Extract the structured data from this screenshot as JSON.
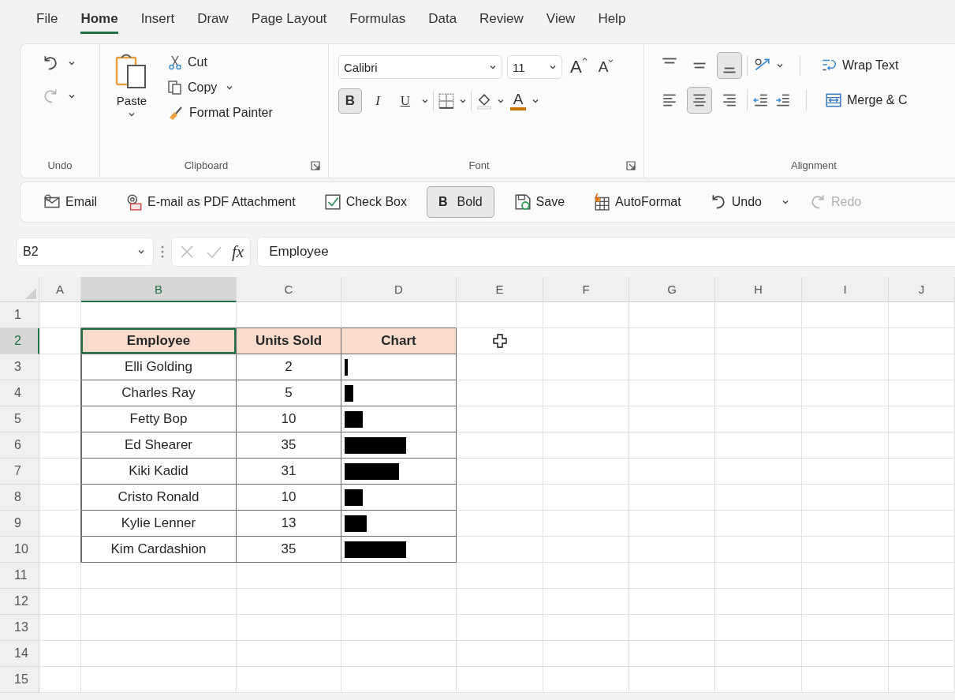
{
  "menu_tabs": [
    {
      "label": "File",
      "selected": false
    },
    {
      "label": "Home",
      "selected": true
    },
    {
      "label": "Insert",
      "selected": false
    },
    {
      "label": "Draw",
      "selected": false
    },
    {
      "label": "Page Layout",
      "selected": false
    },
    {
      "label": "Formulas",
      "selected": false
    },
    {
      "label": "Data",
      "selected": false
    },
    {
      "label": "Review",
      "selected": false
    },
    {
      "label": "View",
      "selected": false
    },
    {
      "label": "Help",
      "selected": false
    }
  ],
  "undo_group": {
    "label": "Undo",
    "redo_disabled": true
  },
  "clipboard": {
    "label": "Clipboard",
    "paste": "Paste",
    "cut": "Cut",
    "copy": "Copy",
    "format_painter": "Format Painter"
  },
  "font": {
    "label": "Font",
    "font_name": "Calibri",
    "font_size": "11",
    "grow": "A",
    "shrink": "A",
    "font_color": "A",
    "styles": [
      {
        "label": "B",
        "selected": true
      },
      {
        "label": "I",
        "selected": false
      },
      {
        "label": "U",
        "selected": false
      }
    ]
  },
  "alignment": {
    "label": "Alignment",
    "wrap_text": "Wrap Text",
    "merge": "Merge & C",
    "vertical": [
      {
        "selected": false
      },
      {
        "selected": false
      },
      {
        "selected": true
      }
    ],
    "horizontal": [
      {
        "selected": false
      },
      {
        "selected": true
      },
      {
        "selected": false
      }
    ]
  },
  "quick_access": [
    {
      "label": "Email",
      "selected": false,
      "disabled": false,
      "dropdown": false
    },
    {
      "label": "E-mail as PDF Attachment",
      "selected": false,
      "disabled": false,
      "dropdown": false
    },
    {
      "label": "Check Box",
      "selected": false,
      "disabled": false,
      "dropdown": false
    },
    {
      "label": "Bold",
      "glyph": "B",
      "selected": true,
      "disabled": false,
      "dropdown": false
    },
    {
      "label": "Save",
      "selected": false,
      "disabled": false,
      "dropdown": false
    },
    {
      "label": "AutoFormat",
      "selected": false,
      "disabled": false,
      "dropdown": false
    },
    {
      "label": "Undo",
      "selected": false,
      "disabled": false,
      "dropdown": true
    },
    {
      "label": "Redo",
      "selected": false,
      "disabled": true,
      "dropdown": false
    }
  ],
  "formula_bar": {
    "name_box": "B2",
    "fx": "fx",
    "value": "Employee"
  },
  "columns": [
    {
      "label": "A",
      "selected": false
    },
    {
      "label": "B",
      "selected": true
    },
    {
      "label": "C",
      "selected": false
    },
    {
      "label": "D",
      "selected": false
    },
    {
      "label": "E",
      "selected": false
    },
    {
      "label": "F",
      "selected": false
    },
    {
      "label": "G",
      "selected": false
    },
    {
      "label": "H",
      "selected": false
    },
    {
      "label": "I",
      "selected": false
    },
    {
      "label": "J",
      "selected": false
    }
  ],
  "rows": [
    {
      "label": "1",
      "selected": false
    },
    {
      "label": "2",
      "selected": true
    },
    {
      "label": "3",
      "selected": false
    },
    {
      "label": "4",
      "selected": false
    },
    {
      "label": "5",
      "selected": false
    },
    {
      "label": "6",
      "selected": false
    },
    {
      "label": "7",
      "selected": false
    },
    {
      "label": "8",
      "selected": false
    },
    {
      "label": "9",
      "selected": false
    },
    {
      "label": "10",
      "selected": false
    },
    {
      "label": "11",
      "selected": false
    },
    {
      "label": "12",
      "selected": false
    },
    {
      "label": "13",
      "selected": false
    },
    {
      "label": "14",
      "selected": false
    },
    {
      "label": "15",
      "selected": false
    }
  ],
  "table": {
    "header": [
      {
        "label": "Employee",
        "selected": true
      },
      {
        "label": "Units Sold",
        "selected": false
      },
      {
        "label": "Chart",
        "selected": false
      }
    ],
    "rows": [
      {
        "employee": "Elli Golding",
        "units": "2",
        "level": 0.03
      },
      {
        "employee": "Charles Ray",
        "units": "5",
        "level": 0.08
      },
      {
        "employee": "Fetty Bop",
        "units": "10",
        "level": 0.16
      },
      {
        "employee": "Ed Shearer",
        "units": "35",
        "level": 0.55
      },
      {
        "employee": "Kiki Kadid",
        "units": "31",
        "level": 0.49
      },
      {
        "employee": "Cristo Ronald",
        "units": "10",
        "level": 0.16
      },
      {
        "employee": "Kylie Lenner",
        "units": "13",
        "level": 0.2
      },
      {
        "employee": "Kim Cardashion",
        "units": "35",
        "level": 0.55
      }
    ]
  }
}
